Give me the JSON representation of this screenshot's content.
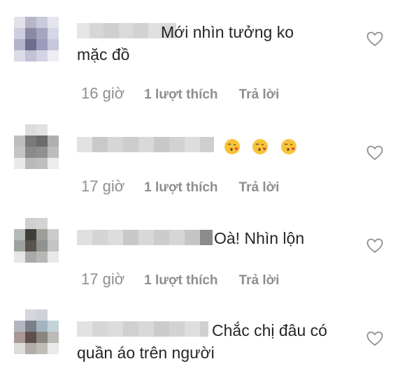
{
  "comments": [
    {
      "username": "",
      "text_line1": "Mới nhìn tưởng ko",
      "text_line2": "mặc đồ",
      "time": "16 giờ",
      "likes": "1 lượt thích",
      "reply": "Trả lời"
    },
    {
      "username": "",
      "emojis": [
        "kissing-face-with-heart-emoji",
        "kissing-face-with-heart-emoji",
        "kissing-face-with-heart-emoji"
      ],
      "time": "17 giờ",
      "likes": "1 lượt thích",
      "reply": "Trả lời"
    },
    {
      "username": "",
      "text_line1": "Oà! Nhìn lộn",
      "time": "17 giờ",
      "likes": "1 lượt thích",
      "reply": "Trả lời"
    },
    {
      "username": "",
      "text_line1": "Chắc chị đâu có",
      "text_line2": "quần áo trên người",
      "time": "",
      "likes": "",
      "reply": ""
    }
  ],
  "colors": {
    "text": "#262626",
    "meta": "#8e8e8e",
    "heart_stroke": "#8e8e8e"
  }
}
